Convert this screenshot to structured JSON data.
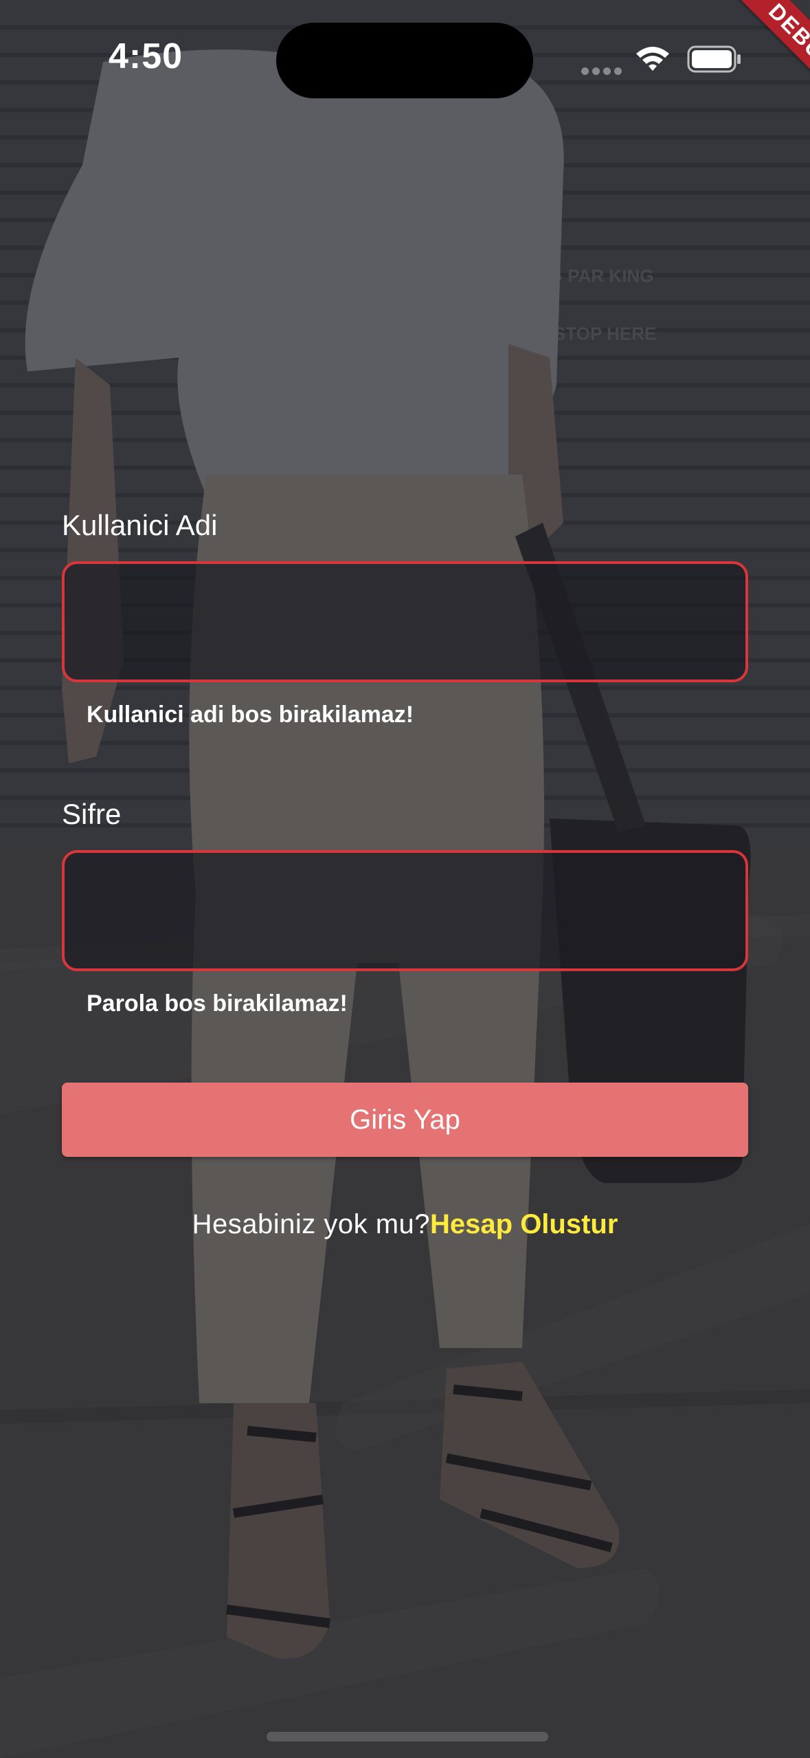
{
  "status_bar": {
    "time": "4:50",
    "wifi_icon": "wifi-icon",
    "battery_icon": "battery-icon",
    "signal_icon": "signal-dots-icon"
  },
  "debug_banner": {
    "label": "DEBUG",
    "color": "#b3222a"
  },
  "background": {
    "wall_sign_1": "NG PAR KING",
    "wall_sign_2": "N STOP HERE"
  },
  "form": {
    "username": {
      "label": "Kullanici Adi",
      "value": "",
      "error": "Kullanici adi bos birakilamaz!"
    },
    "password": {
      "label": "Sifre",
      "value": "",
      "error": "Parola bos birakilamaz!"
    },
    "login_button": {
      "label": "Giris Yap",
      "color": "#e57373"
    },
    "signup": {
      "prompt": "Hesabiniz yok mu?",
      "link": "Hesap Olustur",
      "link_color": "#ffeb3b"
    },
    "error_border_color": "#d9363b"
  }
}
